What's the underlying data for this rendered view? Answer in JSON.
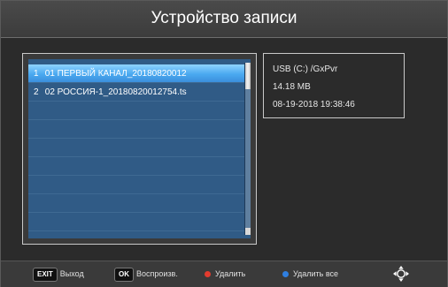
{
  "header": {
    "title": "Устройство записи"
  },
  "recordings": [
    {
      "num": "1",
      "name": "01 ПЕРВЫЙ КАНАЛ_20180820012",
      "selected": true
    },
    {
      "num": "2",
      "name": "02 РОССИЯ-1_20180820012754.ts",
      "selected": false
    }
  ],
  "info": {
    "path": "USB (C:) /GxPvr",
    "size": "14.18 MB",
    "datetime": "08-19-2018 19:38:46"
  },
  "footer": {
    "exit_key": "EXIT",
    "exit_label": "Выход",
    "ok_key": "OK",
    "ok_label": "Воспроизв.",
    "red_label": "Удалить",
    "blue_label": "Удалить все"
  },
  "colors": {
    "red_button": "#e23b2e",
    "blue_button": "#2f7fe0",
    "list_bg": "#305b86",
    "selected_row": "#4aa9f0"
  }
}
